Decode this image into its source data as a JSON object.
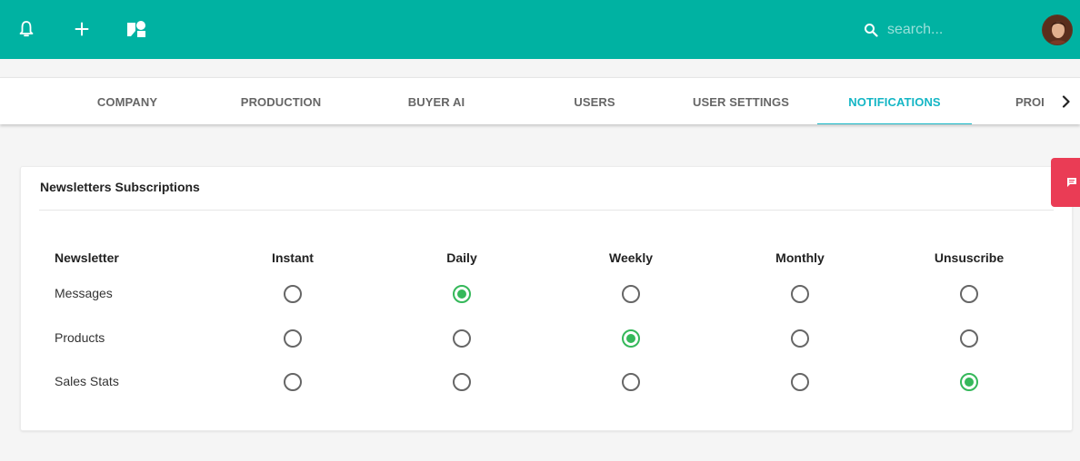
{
  "header": {
    "bg_color": "#00b2a2",
    "icons": [
      {
        "name": "bell-icon"
      },
      {
        "name": "plus-icon"
      },
      {
        "name": "shapes-icon"
      }
    ],
    "search": {
      "placeholder": "search...",
      "value": ""
    }
  },
  "tabs": {
    "items": [
      {
        "label": "COMPANY"
      },
      {
        "label": "PRODUCTION"
      },
      {
        "label": "BUYER AI"
      },
      {
        "label": "USERS"
      },
      {
        "label": "USER SETTINGS"
      },
      {
        "label": "NOTIFICATIONS"
      }
    ],
    "active_index": 5,
    "overflow_label": "PROI",
    "accent_color": "#14b6c5"
  },
  "newsletters": {
    "title": "Newsletters Subscriptions",
    "columns": [
      "Newsletter",
      "Instant",
      "Daily",
      "Weekly",
      "Monthly",
      "Unsuscribe"
    ],
    "rows": [
      {
        "label": "Messages",
        "selected": "Daily"
      },
      {
        "label": "Products",
        "selected": "Weekly"
      },
      {
        "label": "Sales Stats",
        "selected": "Unsuscribe"
      }
    ],
    "checked_color": "#35b85a"
  },
  "feedback": {
    "color": "#ea3c55",
    "icon": "chat-icon"
  }
}
